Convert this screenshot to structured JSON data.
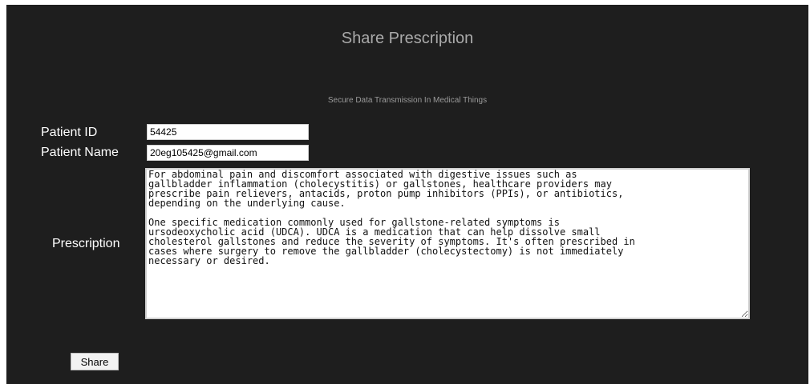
{
  "header": {
    "title": "Share Prescription",
    "subtitle": "Secure Data Transmission In Medical Things"
  },
  "form": {
    "patient_id_label": "Patient ID",
    "patient_id_value": "54425",
    "patient_name_label": "Patient Name",
    "patient_name_value": "20eg105425@gmail.com",
    "prescription_label": "Prescription",
    "prescription_value": "For abdominal pain and discomfort associated with digestive issues such as\ngallbladder inflammation (cholecystitis) or gallstones, healthcare providers may\nprescribe pain relievers, antacids, proton pump inhibitors (PPIs), or antibiotics,\ndepending on the underlying cause.\n\nOne specific medication commonly used for gallstone-related symptoms is\nursodeoxycholic acid (UDCA). UDCA is a medication that can help dissolve small\ncholesterol gallstones and reduce the severity of symptoms. It's often prescribed in\ncases where surgery to remove the gallbladder (cholecystectomy) is not immediately\nnecessary or desired.",
    "share_label": "Share"
  }
}
